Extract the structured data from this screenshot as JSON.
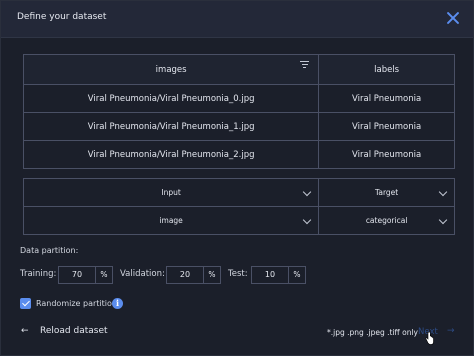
{
  "dialog": {
    "title": "Define your dataset"
  },
  "table": {
    "headers": [
      "images",
      "labels"
    ],
    "rows": [
      [
        "Viral Pneumonia/Viral Pneumonia_0.jpg",
        "Viral Pneumonia"
      ],
      [
        "Viral Pneumonia/Viral Pneumonia_1.jpg",
        "Viral Pneumonia"
      ],
      [
        "Viral Pneumonia/Viral Pneumonia_2.jpg",
        "Viral Pneumonia"
      ]
    ]
  },
  "mapping": {
    "role_images": "Input",
    "role_labels": "Target",
    "type_images": "image",
    "type_labels": "categorical"
  },
  "partition": {
    "section_label": "Data partition:",
    "training_label": "Training:",
    "training_value": "70",
    "validation_label": "Validation:",
    "validation_value": "20",
    "test_label": "Test:",
    "test_value": "10",
    "percent": "%"
  },
  "randomize": {
    "label": "Randomize partition",
    "checked": true,
    "info": "i"
  },
  "footer": {
    "reload_label": "Reload dataset",
    "back_arrow": "←",
    "formats": "*.jpg .png .jpeg .tiff only",
    "next_label": "Next",
    "next_arrow": "→"
  },
  "colors": {
    "accent": "#5b8dee",
    "background": "#1b1f2a",
    "header": "#232838",
    "border": "#4a5065",
    "disabled": "#2d4b84"
  }
}
